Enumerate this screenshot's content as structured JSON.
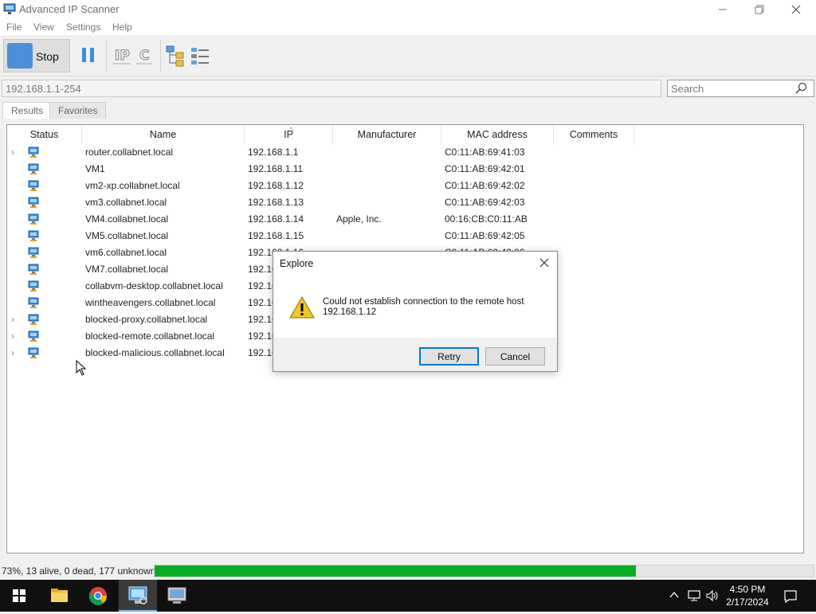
{
  "window": {
    "title": "Advanced IP Scanner"
  },
  "menu": {
    "items": [
      "File",
      "View",
      "Settings",
      "Help"
    ]
  },
  "toolbar": {
    "stop_label": "Stop",
    "buttons": [
      "pause-icon",
      "ip-icon",
      "c-icon",
      "network-tree-icon",
      "list-view-icon"
    ]
  },
  "search": {
    "range_value": "192.168.1.1-254",
    "placeholder": "Search"
  },
  "tabs": [
    {
      "label": "Results",
      "active": true
    },
    {
      "label": "Favorites",
      "active": false
    }
  ],
  "columns": [
    "Status",
    "Name",
    "IP",
    "Manufacturer",
    "MAC address",
    "Comments"
  ],
  "rows": [
    {
      "expandable": true,
      "name": "router.collabnet.local",
      "ip": "192.168.1.1",
      "manufacturer": "",
      "mac": "C0:11:AB:69:41:03"
    },
    {
      "expandable": false,
      "name": "VM1",
      "ip": "192.168.1.11",
      "manufacturer": "",
      "mac": "C0:11:AB:69:42:01"
    },
    {
      "expandable": false,
      "name": "vm2-xp.collabnet.local",
      "ip": "192.168.1.12",
      "manufacturer": "",
      "mac": "C0:11:AB:69:42:02"
    },
    {
      "expandable": false,
      "name": "vm3.collabnet.local",
      "ip": "192.168.1.13",
      "manufacturer": "",
      "mac": "C0:11:AB:69:42:03"
    },
    {
      "expandable": false,
      "name": "VM4.collabnet.local",
      "ip": "192.168.1.14",
      "manufacturer": "Apple, Inc.",
      "mac": "00:16:CB:C0:11:AB"
    },
    {
      "expandable": false,
      "name": "VM5.collabnet.local",
      "ip": "192.168.1.15",
      "manufacturer": "",
      "mac": "C0:11:AB:69:42:05"
    },
    {
      "expandable": false,
      "name": "vm6.collabnet.local",
      "ip": "192.168.1.16",
      "manufacturer": "",
      "mac": "C0:11:AB:69:42:06"
    },
    {
      "expandable": false,
      "name": "VM7.collabnet.local",
      "ip": "192.16",
      "manufacturer": "",
      "mac": ""
    },
    {
      "expandable": false,
      "name": "collabvm-desktop.collabnet.local",
      "ip": "192.16",
      "manufacturer": "",
      "mac": ""
    },
    {
      "expandable": false,
      "name": "wintheavengers.collabnet.local",
      "ip": "192.16",
      "manufacturer": "",
      "mac": ""
    },
    {
      "expandable": true,
      "name": "blocked-proxy.collabnet.local",
      "ip": "192.16",
      "manufacturer": "",
      "mac": ""
    },
    {
      "expandable": true,
      "name": "blocked-remote.collabnet.local",
      "ip": "192.16",
      "manufacturer": "",
      "mac": ""
    },
    {
      "expandable": true,
      "name": "blocked-malicious.collabnet.local",
      "ip": "192.16",
      "manufacturer": "",
      "mac": ""
    }
  ],
  "status_bar": {
    "text": "73%, 13 alive, 0 dead, 177 unknown",
    "progress_percent": 73
  },
  "dialog": {
    "title": "Explore",
    "message_line1": "Could not establish connection to the remote host",
    "message_line2": "192.168.1.12",
    "retry_label": "Retry",
    "cancel_label": "Cancel"
  },
  "taskbar": {
    "apps": [
      "start-icon",
      "file-explorer-icon",
      "chrome-icon",
      "advanced-ip-scanner-icon",
      "remote-desktop-icon"
    ],
    "time": "4:50 PM",
    "date": "2/17/2024"
  },
  "colors": {
    "progress_green": "#06b025",
    "accent_blue": "#0078d7",
    "taskbar_bg": "#101010"
  }
}
